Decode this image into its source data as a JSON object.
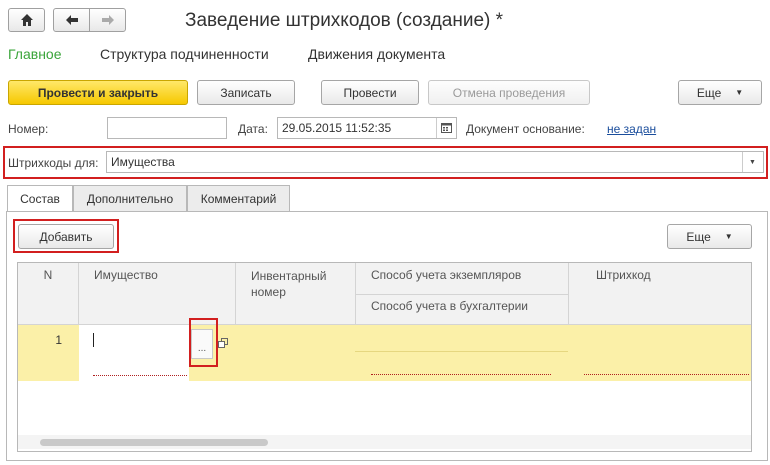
{
  "window": {
    "title": "Заведение штрихкодов (создание) *",
    "nav": {
      "home_icon": "home-icon",
      "back_icon": "arrow-left-icon",
      "forward_icon": "arrow-right-icon"
    }
  },
  "nav_tabs": [
    {
      "label": "Главное",
      "active": true
    },
    {
      "label": "Структура подчиненности"
    },
    {
      "label": "Движения документа"
    }
  ],
  "toolbar": {
    "post_close": "Провести и закрыть",
    "save": "Записать",
    "post": "Провести",
    "unpost": "Отмена проведения",
    "more": "Еще",
    "more_arrow": "▼"
  },
  "header_fields": {
    "number_label": "Номер:",
    "number_value": "",
    "date_label": "Дата:",
    "date_value": "29.05.2015 11:52:35",
    "basis_label": "Документ основание:",
    "basis_value": "не задан",
    "barcodes_for_label": "Штрихкоды для:",
    "barcodes_for_value": "Имущества"
  },
  "page_tabs": [
    {
      "label": "Состав",
      "active": true
    },
    {
      "label": "Дополнительно"
    },
    {
      "label": "Комментарий"
    }
  ],
  "table_toolbar": {
    "add": "Добавить",
    "more": "Еще",
    "more_arrow": "▼"
  },
  "table": {
    "columns": {
      "n": "N",
      "property": "Имущество",
      "inventory_1": "Инвентарный",
      "inventory_2": "номер",
      "method_instances": "Способ учета экземпляров",
      "method_accounting": "Способ учета в бухгалтерии",
      "barcode": "Штрихкод"
    },
    "rows": [
      {
        "n": "1",
        "property": "",
        "inventory": "",
        "method_instances": "",
        "method_accounting": "",
        "barcode": ""
      }
    ],
    "ellipsis": "...",
    "open_icon": "open-window-icon"
  },
  "colors": {
    "accent_green": "#3aa53a",
    "primary_button": "#f6c800",
    "highlight_row": "#fbf0a8",
    "annotation_red": "#d21f1f",
    "link": "#1a4d9c"
  }
}
